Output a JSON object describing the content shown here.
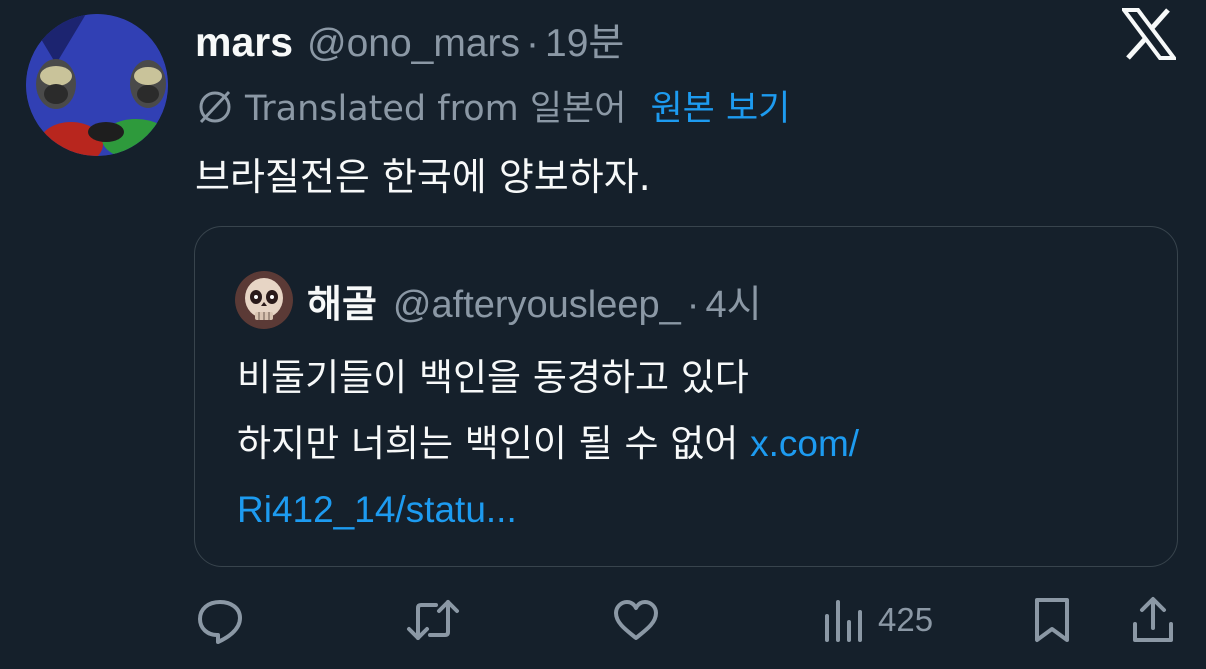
{
  "tweet": {
    "display_name": "mars",
    "handle": "@ono_mars",
    "separator": "·",
    "time": "19분",
    "translated_label": "Translated from 일본어",
    "view_original": "원본 보기",
    "text": "브라질전은 한국에 양보하자."
  },
  "quote": {
    "display_name": "해골",
    "handle": "@afteryousleep_",
    "separator": "·",
    "time": "4시",
    "line1": "비둘기들이 백인을 동경하고 있다",
    "line2_text": "하지만 너희는 백인이 될 수 없어 ",
    "link_part1": "x.com/",
    "link_part2": "Ri412_14/statu..."
  },
  "actions": {
    "views": "425",
    "icons": [
      "reply-icon",
      "retweet-icon",
      "like-icon",
      "views-icon",
      "bookmark-icon",
      "share-icon"
    ]
  },
  "colors": {
    "background": "#15202b",
    "text": "#f7f9f9",
    "secondary": "#8b98a5",
    "accent": "#1d9bf0",
    "border": "#38444d"
  }
}
